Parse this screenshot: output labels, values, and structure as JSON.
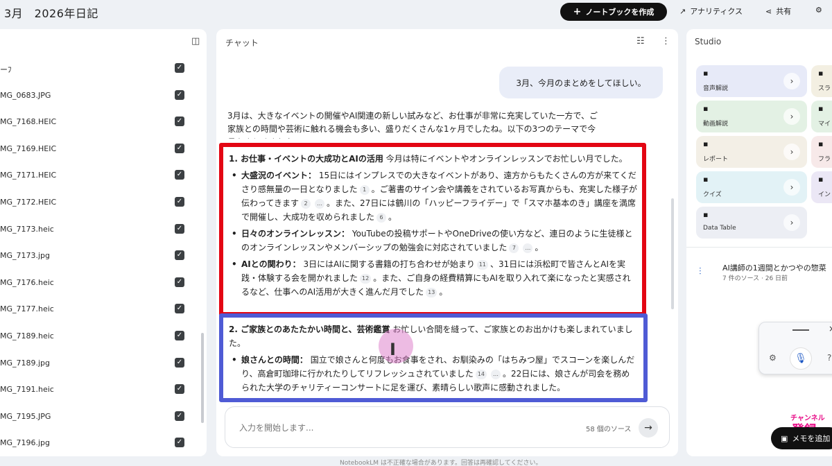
{
  "header": {
    "title": "3月　2026年日記",
    "create_label": "ノートブックを作成",
    "analytics_label": "アナリティクス",
    "share_label": "共有"
  },
  "sources": {
    "items": [
      {
        "name": "ーﾌ",
        "checked": true
      },
      {
        "name": "MG_0683.JPG",
        "checked": true
      },
      {
        "name": "MG_7168.HEIC",
        "checked": true
      },
      {
        "name": "MG_7169.HEIC",
        "checked": true
      },
      {
        "name": "MG_7171.HEIC",
        "checked": true
      },
      {
        "name": "MG_7172.HEIC",
        "checked": true
      },
      {
        "name": "MG_7173.heic",
        "checked": true
      },
      {
        "name": "MG_7173.jpg",
        "checked": true
      },
      {
        "name": "MG_7176.heic",
        "checked": true
      },
      {
        "name": "MG_7177.heic",
        "checked": true
      },
      {
        "name": "MG_7189.heic",
        "checked": true
      },
      {
        "name": "MG_7189.jpg",
        "checked": true
      },
      {
        "name": "MG_7191.heic",
        "checked": true
      },
      {
        "name": "MG_7195.JPG",
        "checked": true
      },
      {
        "name": "MG_7196.jpg",
        "checked": true
      }
    ]
  },
  "chat": {
    "title": "チャット",
    "user_message": "3月、今月のまとめをしてほしい。",
    "intro": "3月は、大きなイベントの開催やAI関連の新しい試みなど、お仕事が非常に充実していた一方で、ご家族との時間や芸術に触れる機会も多い、盛りだくさんな1ヶ月でしたね。以下の3つのテーマで今月をまとめました。",
    "section1": {
      "heading": "1. お仕事・イベントの大成功とAIの活用",
      "lead": " 今月は特にイベントやオンラインレッスンでお忙しい月でした。",
      "b1_title": "大盛況のイベント：",
      "b1_a": " 15日にはインプレスでの大きなイベントがあり、遠方からもたくさんの方が来てくださり感無量の一日となりました",
      "b1_c1": "1",
      "b1_b": "。ご著書のサイン会や講義をされているお写真からも、充実した様子が伝わってきます",
      "b1_c2": "2",
      "b1_c2b": "…",
      "b1_c": "。また、27日には鶴川の「ハッピーフライデー」で「スマホ基本のき」講座を満席で開催し、大成功を収められました",
      "b1_c3": "6",
      "b1_d": "。",
      "b2_title": "日々のオンラインレッスン：",
      "b2_a": " YouTubeの投稿サポートやOneDriveの使い方など、連日のように生徒様とのオンラインレッスンやメンバーシップの勉強会に対応されていました",
      "b2_c1": "7",
      "b2_c1b": "…",
      "b2_b": "。",
      "b3_title": "AIとの関わり：",
      "b3_a": " 3日にはAIに関する書籍の打ち合わせが始まり",
      "b3_c1": "11",
      "b3_b": "、31日には浜松町で皆さんとAIを実践・体験する会を開かれました",
      "b3_c2": "12",
      "b3_c": "。また、ご自身の経費精算にもAIを取り入れて楽になったと実感されるなど、仕事へのAI活用が大きく進んだ月でした",
      "b3_c3": "13",
      "b3_d": "。"
    },
    "section2": {
      "heading": "2. ご家族とのあたたかい時間と、芸術鑑賞",
      "lead": " お忙しい合間を縫って、ご家族とのお出かけも楽しまれていました。",
      "b1_title": "娘さんとの時間：",
      "b1_a": " 国立で娘さんと何度もお食事をされ、お馴染みの「はちみつ屋」でスコーンを楽しんだり、高倉町珈琲に行かれたりしてリフレッシュされていました",
      "b1_c1": "14",
      "b1_c1b": "…",
      "b1_b": "。22日には、娘さんが司会を務められた大学のチャリティーコンサートに足を運び、素晴らしい歌声に感動されました。"
    },
    "input_placeholder": "入力を開始します...",
    "source_count": "58 個のソース"
  },
  "studio": {
    "title": "Studio",
    "tiles": [
      {
        "label": "音声解説",
        "icon": "audio-wave-icon",
        "color": "#e7eaf8"
      },
      {
        "label": "動画解説",
        "icon": "video-icon",
        "color": "#e3f1e4"
      },
      {
        "label": "レポート",
        "icon": "report-icon",
        "color": "#f3efe6"
      },
      {
        "label": "クイズ",
        "icon": "quiz-icon",
        "color": "#e2f2f6"
      },
      {
        "label": "Data Table",
        "icon": "table-icon",
        "color": "#eceef4"
      }
    ],
    "side_tiles": [
      {
        "label": "スラ",
        "color": "#f3efe2"
      },
      {
        "label": "マイ",
        "color": "#e3f1e4"
      },
      {
        "label": "フラ",
        "color": "#f7e9e9"
      },
      {
        "label": "イン",
        "color": "#ebe7f5"
      }
    ],
    "note": {
      "title": "AI講師の1週間とかつやの惣菜",
      "meta": "7 件のソース · 26 日前"
    }
  },
  "memo_label": "メモを追加",
  "channel_text": "チャンネル",
  "channel_big": "登録",
  "footer": "NotebookLM は不正確な場合があります。回答は再確認してください。"
}
